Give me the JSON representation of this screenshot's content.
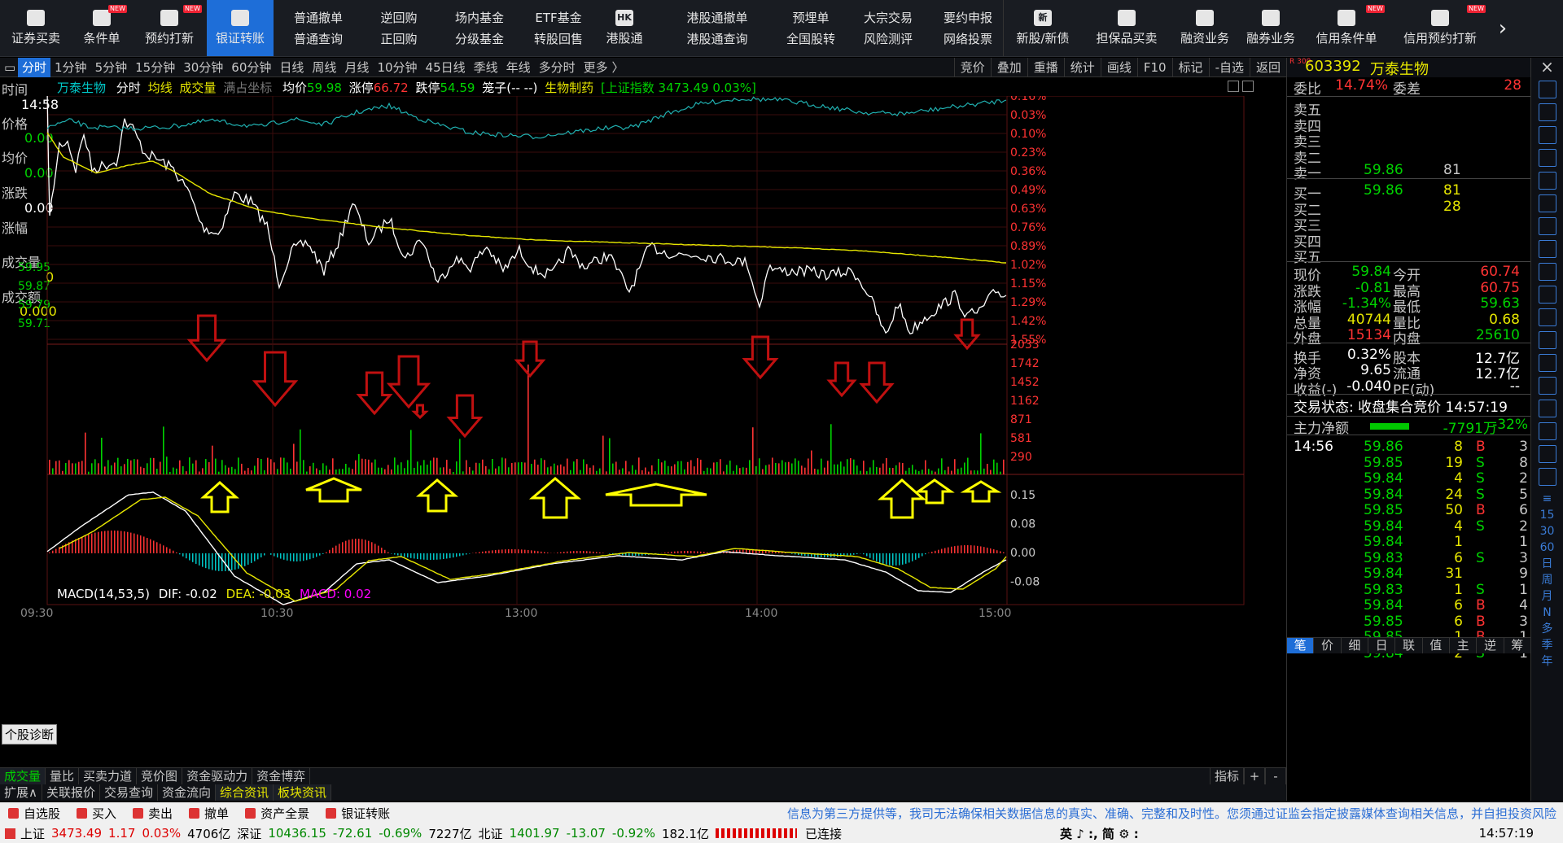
{
  "toolbar": {
    "items": [
      {
        "label": "证券买卖",
        "new": false,
        "active": false,
        "w": 88
      },
      {
        "label": "条件单",
        "new": true,
        "active": false,
        "w": 74
      },
      {
        "label": "预约打新",
        "new": true,
        "active": false,
        "w": 92
      },
      {
        "label": "银证转账",
        "new": false,
        "active": true,
        "w": 82
      }
    ],
    "pairs": [
      {
        "top": "普通撤单",
        "bottom": "普通查询",
        "w": 110
      },
      {
        "top": "逆回购",
        "bottom": "正回购",
        "w": 88
      },
      {
        "top": "场内基金",
        "bottom": "分级基金",
        "w": 110
      },
      {
        "top": "ETF基金",
        "bottom": "转股回售",
        "w": 84
      }
    ],
    "items2": [
      {
        "label": "港股通",
        "icon": "HK",
        "new": false,
        "w": 78
      }
    ],
    "pairs2": [
      {
        "top": "港股通撤单",
        "bottom": "港股通查询",
        "w": 150
      },
      {
        "top": "预埋单",
        "bottom": "全国股转",
        "w": 80
      },
      {
        "top": "大宗交易",
        "bottom": "风险测评",
        "w": 110
      },
      {
        "top": "要约申报",
        "bottom": "网络投票",
        "w": 86
      }
    ],
    "items3": [
      {
        "label": "新股/新债",
        "icon": "新",
        "new": false,
        "w": 96
      },
      {
        "label": "担保品买卖",
        "icon": "",
        "new": false,
        "w": 110
      },
      {
        "label": "融资业务",
        "icon": "",
        "new": false,
        "w": 82
      },
      {
        "label": "融券业务",
        "icon": "",
        "new": false,
        "w": 80
      },
      {
        "label": "信用条件单",
        "icon": "",
        "new": true,
        "w": 106
      },
      {
        "label": "信用预约打新",
        "icon": "",
        "new": true,
        "w": 124
      }
    ],
    "more": "›"
  },
  "periods": [
    "分时",
    "1分钟",
    "5分钟",
    "15分钟",
    "30分钟",
    "60分钟",
    "日线",
    "周线",
    "月线",
    "10分钟",
    "45日线",
    "季线",
    "年线",
    "多分时",
    "更多 〉"
  ],
  "tools": [
    "竞价",
    "叠加",
    "重播",
    "统计",
    "画线",
    "F10",
    "标记",
    "-自选",
    "返回"
  ],
  "info": {
    "name": "万泰生物",
    "mode": "分时",
    "avg": "均线",
    "vol": "成交量",
    "coord": "满占坐标",
    "avgprice_label": "均价",
    "avgprice": "59.98",
    "limitup_label": "涨停",
    "limitup": "66.72",
    "limitdown_label": "跌停",
    "limitdown": "54.59",
    "cage": "笼子(-- --)",
    "sector": "生物制药",
    "index": "[上证指数 3473.49 0.03%]"
  },
  "left_labels": {
    "time_label": "时间",
    "time": "14:58",
    "price_label": "价格",
    "price": "0.00",
    "avg_label": "均价",
    "avg": "0.00",
    "chg_label": "涨跌",
    "chg": "0.00",
    "chgpct_label": "涨幅",
    "vol_label": "成交量",
    "vol": "0",
    "amt_label": "成交额",
    "amt": "0.000"
  },
  "price_axis": [
    "59.95",
    "59.87",
    "59.79",
    "59.71"
  ],
  "pct_axis": [
    "0.16%",
    "0.03%",
    "0.10%",
    "0.23%",
    "0.36%",
    "0.49%",
    "0.63%",
    "0.76%",
    "0.89%",
    "1.02%",
    "1.15%",
    "1.29%",
    "1.42%",
    "1.55%"
  ],
  "vol_axis": [
    "2033",
    "1742",
    "1452",
    "1162",
    "871",
    "581",
    "290"
  ],
  "macd": {
    "title": "MACD(14,53,5)",
    "dif": "DIF: -0.02",
    "dea": "DEA: -0.03",
    "macd": "MACD: 0.02",
    "axis": [
      "0.15",
      "0.08",
      "0.00",
      "-0.08"
    ]
  },
  "diag": "个股诊断",
  "time_axis": [
    "09:30",
    "10:30",
    "13:00",
    "14:00",
    "15:00"
  ],
  "bottom_tabs": [
    "成交量",
    "量比",
    "买卖力道",
    "竞价图",
    "资金驱动力",
    "资金博弈"
  ],
  "bottom_tabs2": [
    "扩展∧",
    "关联报价",
    "交易查询",
    "资金流向",
    "综合资讯",
    "板块资讯"
  ],
  "bottom_right": [
    "指标",
    "+",
    "-"
  ],
  "right": {
    "code": "603392",
    "name": "万泰生物",
    "badge": "R 300",
    "weibi_label": "委比",
    "weibi": "14.74%",
    "weicha_label": "委差",
    "weicha": "28",
    "sells": [
      {
        "l": "卖五",
        "p": "",
        "v": ""
      },
      {
        "l": "卖四",
        "p": "",
        "v": ""
      },
      {
        "l": "卖三",
        "p": "",
        "v": ""
      },
      {
        "l": "卖二",
        "p": "",
        "v": ""
      },
      {
        "l": "卖一",
        "p": "59.86",
        "v": "81"
      }
    ],
    "buys": [
      {
        "l": "买一",
        "p": "59.86",
        "v": "81"
      },
      {
        "l": "买二",
        "p": "",
        "v": "28"
      },
      {
        "l": "买三",
        "p": "",
        "v": ""
      },
      {
        "l": "买四",
        "p": "",
        "v": ""
      },
      {
        "l": "买五",
        "p": "",
        "v": ""
      }
    ],
    "quotes": [
      {
        "l1": "现价",
        "v1": "59.84",
        "l2": "今开",
        "v2": "60.74",
        "c1": "green",
        "c2": "red"
      },
      {
        "l1": "涨跌",
        "v1": "-0.81",
        "l2": "最高",
        "v2": "60.75",
        "c1": "green",
        "c2": "red"
      },
      {
        "l1": "涨幅",
        "v1": "-1.34%",
        "l2": "最低",
        "v2": "59.63",
        "c1": "green",
        "c2": "green"
      },
      {
        "l1": "总量",
        "v1": "40744",
        "l2": "量比",
        "v2": "0.68",
        "c1": "yellow",
        "c2": "yellow"
      },
      {
        "l1": "外盘",
        "v1": "15134",
        "l2": "内盘",
        "v2": "25610",
        "c1": "red",
        "c2": "green"
      },
      {
        "l1": "换手",
        "v1": "0.32%",
        "l2": "股本",
        "v2": "12.7亿",
        "c1": "white",
        "c2": "white"
      },
      {
        "l1": "净资",
        "v1": "9.65",
        "l2": "流通",
        "v2": "12.7亿",
        "c1": "white",
        "c2": "white"
      },
      {
        "l1": "收益(-)",
        "v1": "-0.040",
        "l2": "PE(动)",
        "v2": "--",
        "c1": "white",
        "c2": "white"
      }
    ],
    "trade_state": "交易状态: 收盘集合竞价 14:57:19",
    "main_net_label": "主力净额",
    "main_net": "-7791万",
    "main_pct": "-32%",
    "ticks": [
      {
        "t": "14:56",
        "p": "59.86",
        "v": "8",
        "d": "B",
        "n": "3"
      },
      {
        "t": "",
        "p": "59.85",
        "v": "19",
        "d": "S",
        "n": "8"
      },
      {
        "t": "",
        "p": "59.84",
        "v": "4",
        "d": "S",
        "n": "2"
      },
      {
        "t": "",
        "p": "59.84",
        "v": "24",
        "d": "S",
        "n": "5"
      },
      {
        "t": "",
        "p": "59.85",
        "v": "50",
        "d": "B",
        "n": "6"
      },
      {
        "t": "",
        "p": "59.84",
        "v": "4",
        "d": "S",
        "n": "2"
      },
      {
        "t": "",
        "p": "59.84",
        "v": "1",
        "d": "",
        "n": "1"
      },
      {
        "t": "",
        "p": "59.83",
        "v": "6",
        "d": "S",
        "n": "3"
      },
      {
        "t": "",
        "p": "59.84",
        "v": "31",
        "d": "",
        "n": "9"
      },
      {
        "t": "",
        "p": "59.83",
        "v": "1",
        "d": "S",
        "n": "1"
      },
      {
        "t": "",
        "p": "59.84",
        "v": "6",
        "d": "B",
        "n": "4"
      },
      {
        "t": "",
        "p": "59.85",
        "v": "6",
        "d": "B",
        "n": "3"
      },
      {
        "t": "",
        "p": "59.85",
        "v": "1",
        "d": "B",
        "n": "1"
      },
      {
        "t": "",
        "p": "59.84",
        "v": "2",
        "d": "S",
        "n": "1"
      }
    ],
    "bottom_tabs": [
      "笔",
      "价",
      "细",
      "日",
      "联",
      "值",
      "主",
      "逆",
      "筹"
    ]
  },
  "side_icons": [
    "Fs",
    "K",
    "D",
    "Fiz",
    "≡",
    "15",
    "30",
    "60",
    "日",
    "周",
    "月",
    "N",
    "多",
    "季",
    "年"
  ],
  "status1": {
    "items": [
      "自选股",
      "买入",
      "卖出",
      "撤单",
      "资产全景",
      "银证转账"
    ],
    "notice": "信息为第三方提供等，我司无法确保相关数据信息的真实、准确、完整和及时性。您须通过证监会指定披露媒体查询相关信息，并自担投资风险"
  },
  "status2": {
    "sh_label": "上证",
    "sh": "3473.49",
    "sh_chg": "1.17",
    "sh_pct": "0.03%",
    "sh_amt": "4706亿",
    "sz_label": "深证",
    "sz": "10436.15",
    "sz_chg": "-72.61",
    "sz_pct": "-0.69%",
    "sz_amt": "7227亿",
    "bz_label": "北证",
    "bz": "1401.97",
    "bz_chg": "-13.07",
    "bz_pct": "-0.92%",
    "bz_amt": "182.1亿",
    "conn": "已连接",
    "ime": "英 ♪ :, 简 ⚙ :",
    "clock": "14:57:19"
  },
  "colors": {
    "price": "#ffffff",
    "avg": "#e6e600",
    "index": "#20b0b0",
    "up": "#ff3333",
    "down": "#00d200",
    "arrow_red": "#c01010",
    "arrow_yellow": "#ffff00"
  }
}
